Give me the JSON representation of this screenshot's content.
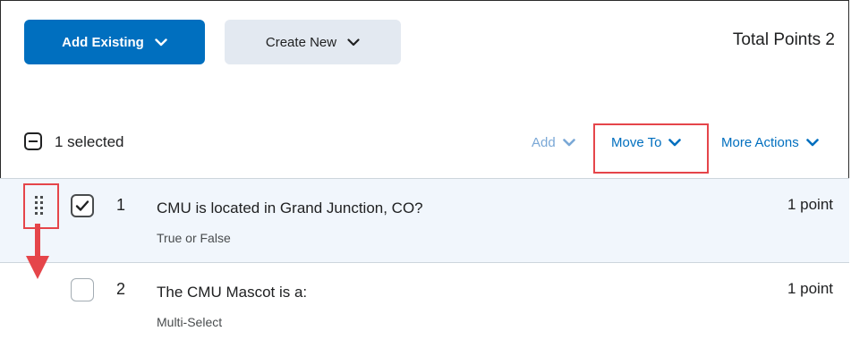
{
  "header": {
    "add_existing_label": "Add Existing",
    "create_new_label": "Create New",
    "total_points_label": "Total Points 2"
  },
  "toolbar": {
    "selected_text": "1 selected",
    "add_label": "Add",
    "move_to_label": "Move To",
    "more_actions_label": "More Actions"
  },
  "questions": [
    {
      "number": "1",
      "title": "CMU is located in Grand Junction, CO?",
      "type": "True or False",
      "points": "1 point",
      "checked": true
    },
    {
      "number": "2",
      "title": "The CMU Mascot is a:",
      "type": "Multi-Select",
      "points": "1 point",
      "checked": false
    }
  ],
  "colors": {
    "primary": "#006fbf",
    "secondary_bg": "#e3e9f1",
    "selected_row_bg": "#f1f6fc",
    "annotation_red": "#e5454a"
  }
}
